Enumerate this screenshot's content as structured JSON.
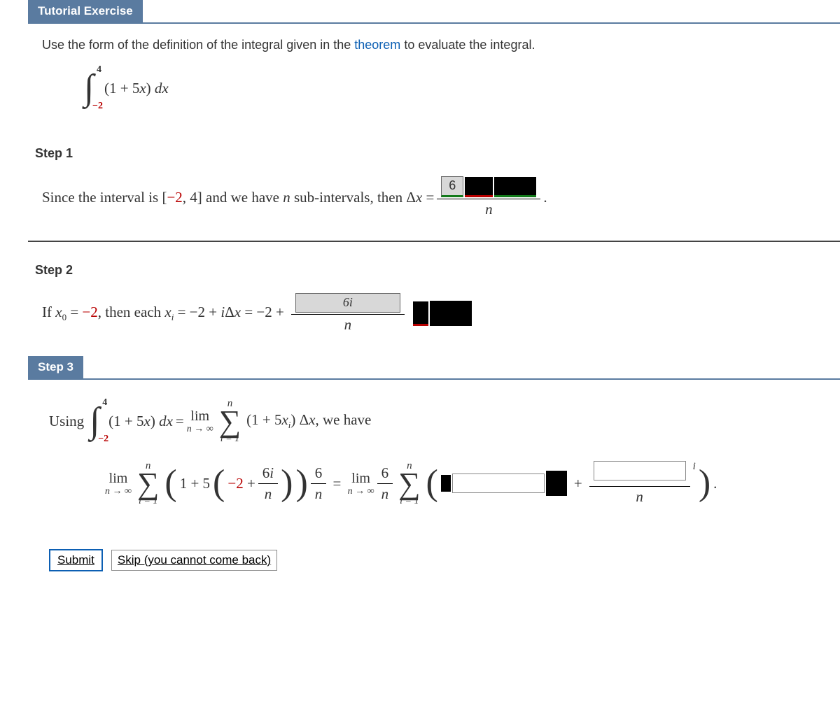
{
  "tutorial": {
    "header_label": "Tutorial Exercise",
    "prompt_pre": "Use the form of the definition of the integral given in the ",
    "theorem_link": "theorem",
    "prompt_post": " to evaluate the integral.",
    "integral_upper": "4",
    "integral_lower": "−2",
    "integral_body": "(1 + 5x) dx"
  },
  "step1": {
    "label": "Step 1",
    "text_pre": "Since the interval is [",
    "interval_neg": "−2",
    "text_mid1": ", 4] and we have ",
    "n_var": "n",
    "text_mid2": " sub-intervals, then Δ",
    "x_var": "x",
    "equals": " = ",
    "num_filled": "6",
    "den_var": "n",
    "period": "."
  },
  "step2": {
    "label": "Step 2",
    "text": "If x",
    "sub0": "0",
    "eq1": " = ",
    "neg2a": "−2",
    "then": ", then each ",
    "xi": "x",
    "subi": "i",
    "eq2": " = −2 + ",
    "idx": "iΔx",
    "eq3": " = −2 + ",
    "frac_num_filled": "6i",
    "frac_den": "n"
  },
  "step3": {
    "header_label": "Step 3",
    "using": "Using",
    "int_upper": "4",
    "int_lower": "−2",
    "int_body": "(1 + 5x) dx",
    "eq": " = ",
    "lim_top": "lim",
    "lim_bot": "n → ∞",
    "sigma_sup": "n",
    "sigma_sub": "i = 1",
    "sum_body": "(1 + 5x",
    "sub_i": "i",
    "sum_body2": ") Δx, we have",
    "inner1": "1 + 5",
    "neg2": "−2 + ",
    "six_i": "6i",
    "n_var": "n",
    "sixover": "6",
    "plus": "+",
    "i_var": "i"
  },
  "submit": {
    "button": "Submit",
    "skip": "Skip (you cannot come back)"
  }
}
